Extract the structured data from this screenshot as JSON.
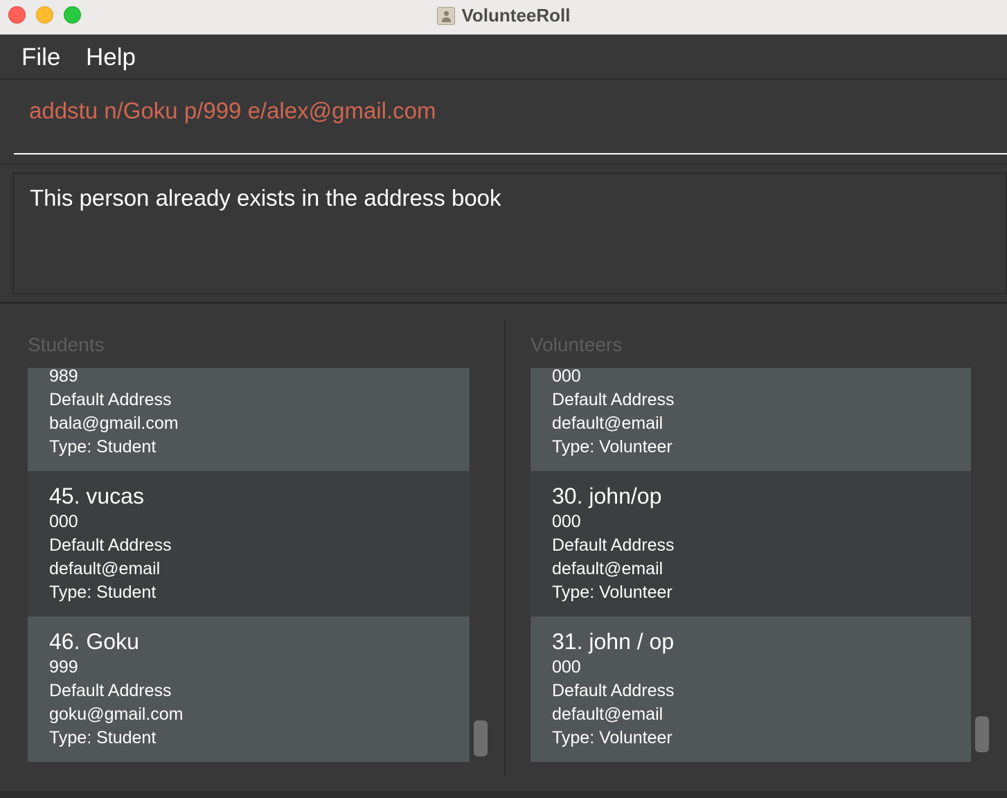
{
  "window": {
    "title": "VolunteeRoll",
    "icon": "contacts-app-icon"
  },
  "menu": {
    "file": "File",
    "help": "Help"
  },
  "command": {
    "value": "addstu n/Goku p/999 e/alex@gmail.com"
  },
  "result": {
    "message": "This person already exists in the address book"
  },
  "students": {
    "heading": "Students",
    "cards": [
      {
        "name": "",
        "phone": "989",
        "address": "Default Address",
        "email": "bala@gmail.com",
        "type": "Type: Student"
      },
      {
        "name": "45. vucas",
        "phone": "000",
        "address": "Default Address",
        "email": "default@email",
        "type": "Type: Student"
      },
      {
        "name": "46. Goku",
        "phone": "999",
        "address": "Default Address",
        "email": "goku@gmail.com",
        "type": "Type: Student"
      }
    ]
  },
  "volunteers": {
    "heading": "Volunteers",
    "cards": [
      {
        "name": "",
        "phone": "000",
        "address": "Default Address",
        "email": "default@email",
        "type": "Type: Volunteer"
      },
      {
        "name": "30. john/op",
        "phone": "000",
        "address": "Default Address",
        "email": "default@email",
        "type": "Type: Volunteer"
      },
      {
        "name": "31. john / op",
        "phone": "000",
        "address": "Default Address",
        "email": "default@email",
        "type": "Type: Volunteer"
      }
    ]
  },
  "colors": {
    "background": "#383838",
    "command_text": "#d06651",
    "card_light": "#515658",
    "card_dark": "#3c3e3f",
    "heading_text": "#5e5e5e"
  }
}
